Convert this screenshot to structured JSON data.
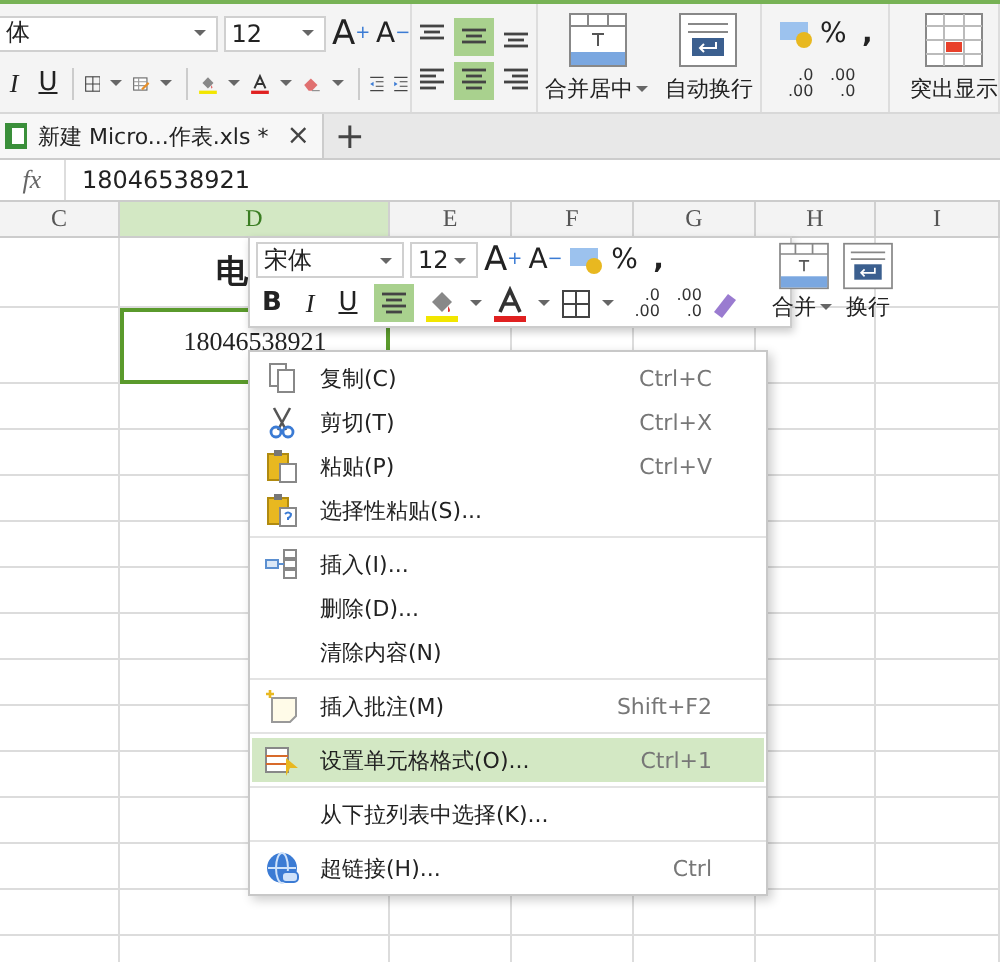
{
  "ribbon": {
    "font_name": "体",
    "font_size": "12",
    "grow": "A",
    "grow_sign": "+",
    "shrink": "A",
    "shrink_sign": "−",
    "increase_decimal": [
      ".0",
      ".00"
    ],
    "decrease_decimal": [
      ".00",
      ".0"
    ],
    "italic": "I",
    "underline": "U",
    "align_buttons": [
      {
        "selected": false
      },
      {
        "selected": true
      },
      {
        "selected": false
      },
      {
        "selected": false
      },
      {
        "selected": true
      },
      {
        "selected": false
      }
    ],
    "merge": "合并居中",
    "wrap": "自动换行",
    "percent": "%",
    "comma": ",",
    "highlight": "突出显示"
  },
  "tab": {
    "title": "新建 Micro...作表.xls *",
    "close": "×",
    "add": "+"
  },
  "formula_bar": {
    "fx": "fx",
    "value": "18046538921"
  },
  "columns": [
    {
      "label": "C",
      "selected": false
    },
    {
      "label": "D",
      "selected": true
    },
    {
      "label": "E",
      "selected": false
    },
    {
      "label": "F",
      "selected": false
    },
    {
      "label": "G",
      "selected": false
    },
    {
      "label": "H",
      "selected": false
    },
    {
      "label": "I",
      "selected": false
    }
  ],
  "sheet": {
    "title_cell": "电",
    "active_cell": "18046538921"
  },
  "mini_toolbar": {
    "font_name": "宋体",
    "font_size": "12",
    "grow": "A",
    "grow_sign": "+",
    "shrink": "A",
    "shrink_sign": "−",
    "increase_decimal": [
      ".0",
      ".00"
    ],
    "decrease_decimal": [
      ".00",
      ".0"
    ],
    "percent": "%",
    "comma": ",",
    "merge": "合并",
    "wrap": "换行",
    "format_buttons": [
      {
        "label": "B",
        "selected": false
      },
      {
        "label": "I",
        "selected": false
      },
      {
        "label": "U",
        "selected": false
      }
    ],
    "center_selected": true
  },
  "context_menu": [
    {
      "label": "复制(C)",
      "shortcut": "Ctrl+C",
      "separator_above": false,
      "selected": false
    },
    {
      "label": "剪切(T)",
      "shortcut": "Ctrl+X",
      "separator_above": false,
      "selected": false
    },
    {
      "label": "粘贴(P)",
      "shortcut": "Ctrl+V",
      "separator_above": false,
      "selected": false
    },
    {
      "label": "选择性粘贴(S)...",
      "separator_above": false,
      "selected": false
    },
    {
      "label": "插入(I)...",
      "separator_above": true,
      "selected": false
    },
    {
      "label": "删除(D)...",
      "separator_above": false,
      "selected": false
    },
    {
      "label": "清除内容(N)",
      "separator_above": false,
      "selected": false
    },
    {
      "label": "插入批注(M)",
      "shortcut": "Shift+F2",
      "separator_above": true,
      "selected": false
    },
    {
      "label": "设置单元格格式(O)...",
      "shortcut": "Ctrl+1",
      "separator_above": true,
      "selected": true
    },
    {
      "label": "从下拉列表中选择(K)...",
      "separator_above": true,
      "selected": false
    },
    {
      "label": "超链接(H)...",
      "shortcut": "Ctrl",
      "separator_above": true,
      "selected": false
    }
  ]
}
